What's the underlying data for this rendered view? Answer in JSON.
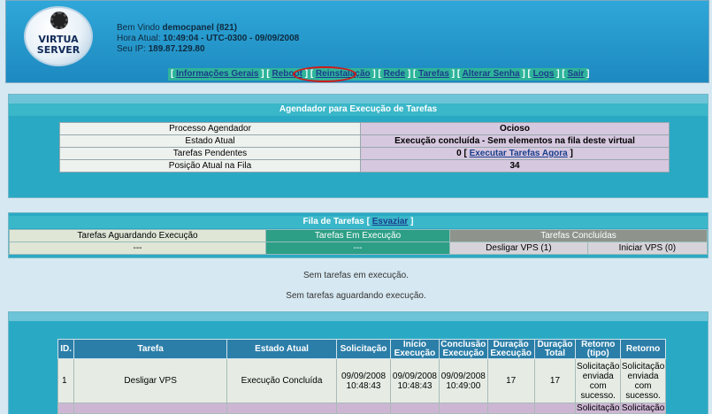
{
  "logo": {
    "line1": "VIRTUA",
    "line2": "SERVER"
  },
  "welcome": {
    "greeting": "Bem Vindo ",
    "user": "democpanel (821)",
    "time_label": "Hora Atual: ",
    "time_value": "10:49:04 - UTC-0300 - 09/09/2008",
    "ip_label": "Seu IP: ",
    "ip_value": "189.87.129.80"
  },
  "nav": {
    "items": [
      "Informações Gerais",
      "Reboot",
      "Reinstalação",
      "Rede",
      "Tarefas",
      "Alterar Senha",
      "Logs",
      "Sair"
    ]
  },
  "scheduler": {
    "title": "Agendador para Execução de Tarefas",
    "rows": [
      {
        "label": "Processo Agendador",
        "value": "Ocioso"
      },
      {
        "label": "Estado Atual",
        "value": "Execução concluída - Sem elementos na fila deste virtual"
      },
      {
        "label": "Tarefas Pendentes",
        "value": "0",
        "link": "Executar Tarefas Agora"
      },
      {
        "label": "Posição Atual na Fila",
        "value": "34"
      }
    ]
  },
  "queue": {
    "title": "Fila de Tarefas",
    "clear_link": "Esvaziar",
    "headers": [
      "Tarefas Aguardando Execução",
      "Tarefas Em Execução",
      "Tarefas Concluídas"
    ],
    "waiting": "---",
    "running": "---",
    "done": [
      "Desligar VPS (1)",
      "Iniciar VPS (0)"
    ]
  },
  "messages": {
    "none_running": "Sem tarefas em execução.",
    "none_waiting": "Sem tarefas aguardando execução."
  },
  "tasks": {
    "headers": [
      "ID.",
      "Tarefa",
      "Estado Atual",
      "Solicitação",
      "Início Execução",
      "Conclusão Execução",
      "Duração Execução",
      "Duração Total",
      "Retorno (tipo)",
      "Retorno"
    ],
    "rows": [
      {
        "id": "1",
        "task": "Desligar VPS",
        "state": "Execução Concluída",
        "requested": "09/09/2008 10:48:43",
        "started": "09/09/2008 10:48:43",
        "finished": "09/09/2008 10:49:00",
        "exec_duration": "17",
        "total_duration": "17",
        "return_type": "Solicitação enviada com sucesso.",
        "return": "Solicitação enviada com sucesso."
      }
    ],
    "next_row_partial": [
      "Solicitação",
      "Solicitação"
    ]
  }
}
